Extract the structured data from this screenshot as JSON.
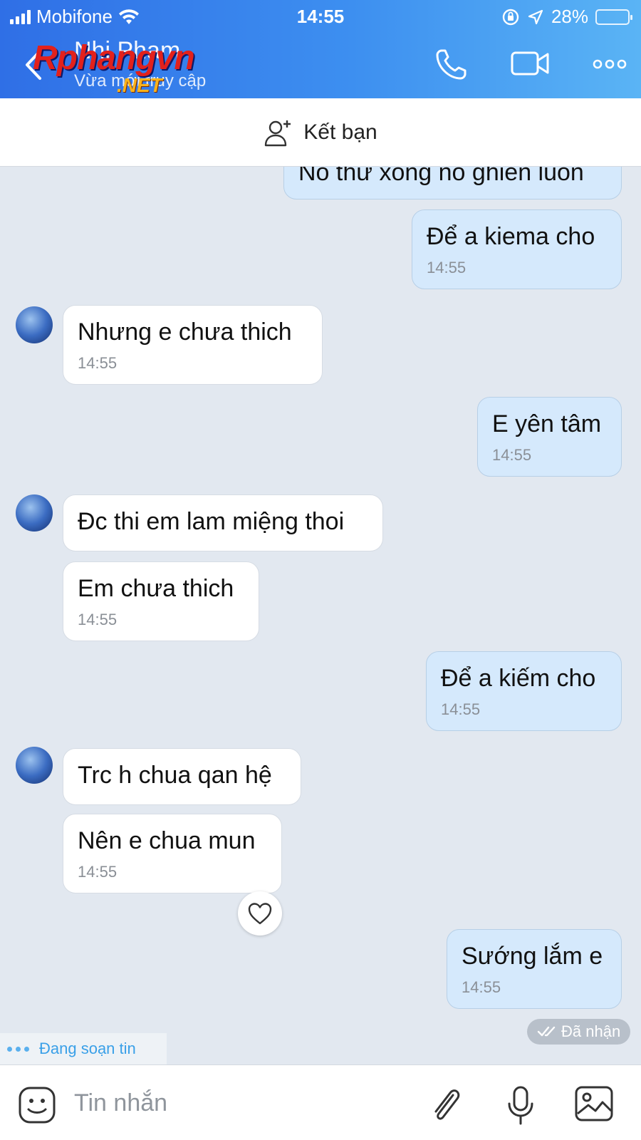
{
  "status_bar": {
    "carrier": "Mobifone",
    "time": "14:55",
    "battery": "28%",
    "battery_level": 0.28
  },
  "header": {
    "contact_name": "Nhi Phạm",
    "subtitle": "Vừa mới truy cập"
  },
  "watermark": {
    "line1": "Rphangvn",
    "line2": ".NET"
  },
  "add_friend": {
    "label": "Kết bạn"
  },
  "messages": [
    {
      "side": "me",
      "text": "Nó thử xong nó ghiền luôn"
    },
    {
      "side": "me",
      "text": "Để a kiema cho",
      "time": "14:55"
    },
    {
      "side": "them",
      "text": "Nhưng e chưa thich",
      "time": "14:55"
    },
    {
      "side": "me",
      "text": "E yên tâm",
      "time": "14:55"
    },
    {
      "side": "them",
      "text": "Đc thi em lam miệng thoi"
    },
    {
      "side": "them",
      "text": "Em chưa thich",
      "time": "14:55"
    },
    {
      "side": "me",
      "text": "Để a kiếm cho",
      "time": "14:55"
    },
    {
      "side": "them",
      "text": "Trc h chua qan hệ"
    },
    {
      "side": "them",
      "text": "Nên e chua mun",
      "time": "14:55"
    },
    {
      "side": "me",
      "text": "Sướng lắm e",
      "time": "14:55"
    }
  ],
  "receipt": "Đã nhận",
  "typing_indicator": "Đang soạn tin",
  "composer": {
    "placeholder": "Tin nhắn"
  }
}
